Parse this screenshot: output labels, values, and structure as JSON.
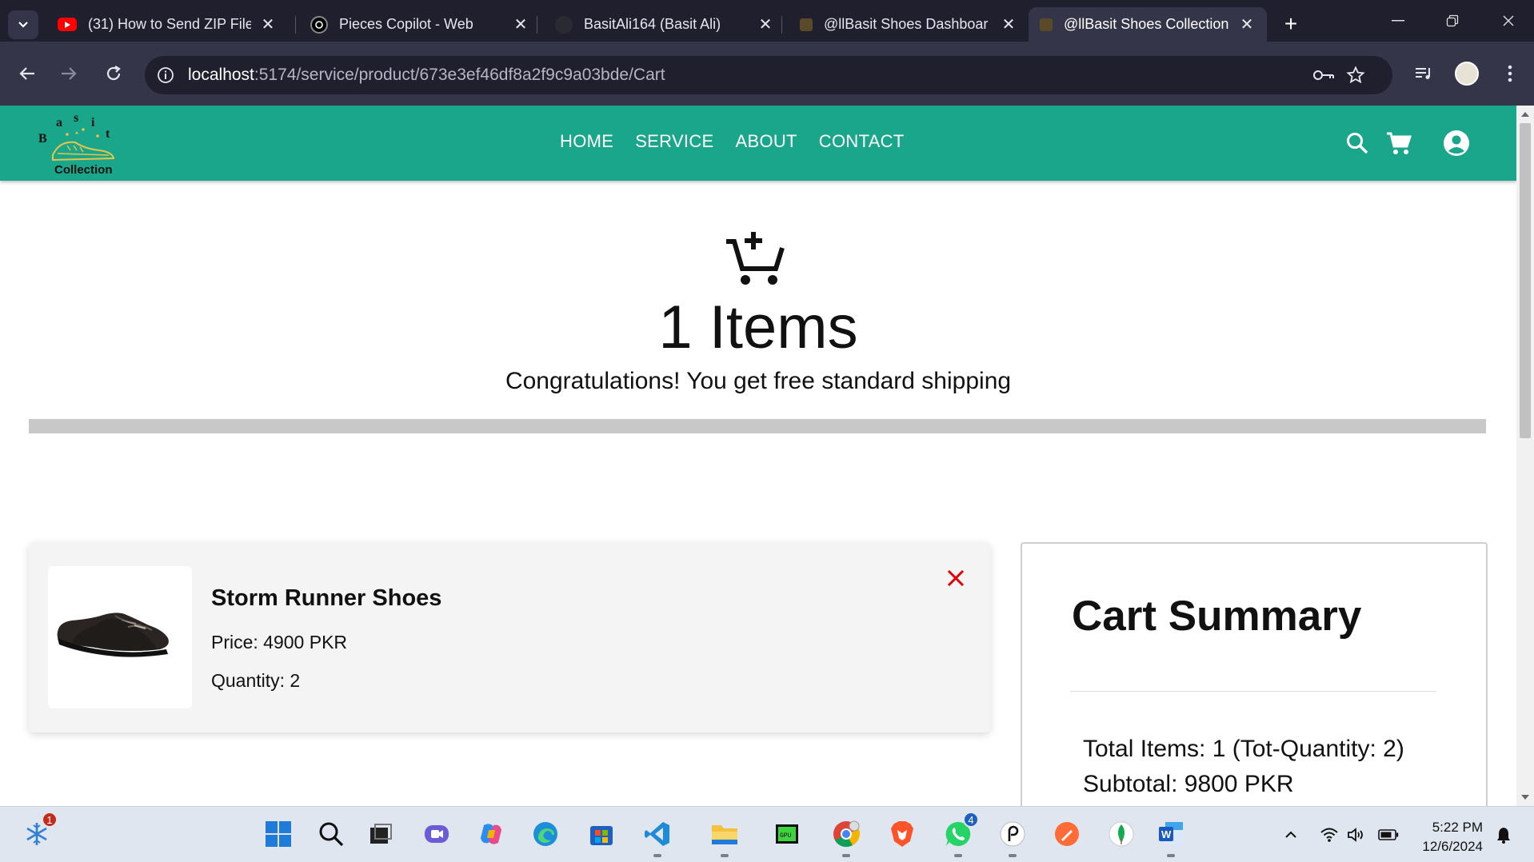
{
  "browser": {
    "tabs": [
      {
        "title": "(31) How to Send ZIP File",
        "icon": "youtube-icon",
        "active": false
      },
      {
        "title": "Pieces Copilot - Web",
        "icon": "pieces-icon",
        "active": false
      },
      {
        "title": "BasitAli164 (Basit Ali)",
        "icon": "github-icon",
        "active": false
      },
      {
        "title": "@llBasit Shoes Dashboar",
        "icon": "shoe-favicon",
        "active": false
      },
      {
        "title": "@llBasit Shoes Collection",
        "icon": "shoe-favicon",
        "active": true
      }
    ],
    "url_host": "localhost",
    "url_rest": ":5174/service/product/673e3ef46df8a2f9c9a03bde/Cart"
  },
  "site": {
    "logo_text": "Collection",
    "logo_letters": [
      "B",
      "a",
      "s",
      "i",
      "t"
    ],
    "nav": [
      "HOME",
      "SERVICE",
      "ABOUT",
      "CONTACT"
    ]
  },
  "hero": {
    "count_text": "1 Items",
    "message": "Congratulations! You get free standard shipping",
    "shipping_progress": 1.0
  },
  "cart_item": {
    "name": "Storm Runner Shoes",
    "price": "Price: 4900 PKR",
    "quantity": "Quantity: 2"
  },
  "summary": {
    "title": "Cart Summary",
    "total_items": "Total Items: 1 (Tot-Quantity: 2)",
    "subtotal": "Subtotal: 9800 PKR"
  },
  "taskbar": {
    "weather_badge": "1",
    "whatsapp_badge": "4",
    "time": "5:22 PM",
    "date": "12/6/2024"
  },
  "colors": {
    "header": "#1aa68a",
    "remove": "#e00000",
    "chrome_dark": "#1f1f2e",
    "chrome_mid": "#35354a"
  }
}
